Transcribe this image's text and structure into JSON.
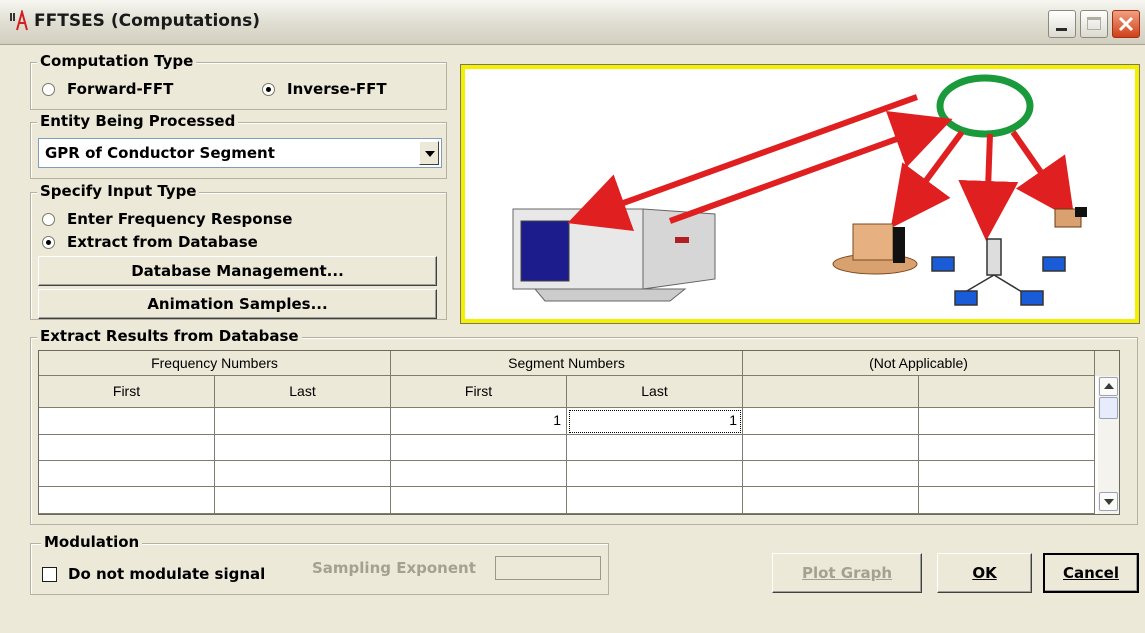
{
  "window": {
    "title": "FFTSES (Computations)"
  },
  "computation_type": {
    "legend": "Computation Type",
    "options": [
      {
        "label": "Forward-FFT",
        "selected": false
      },
      {
        "label": "Inverse-FFT",
        "selected": true
      }
    ]
  },
  "entity": {
    "legend": "Entity Being Processed",
    "selected": "GPR of Conductor Segment"
  },
  "input_type": {
    "legend": "Specify Input Type",
    "options": [
      {
        "label": "Enter Frequency Response",
        "selected": false
      },
      {
        "label": "Extract from Database",
        "selected": true
      }
    ],
    "db_button": "Database Management...",
    "anim_button": "Animation Samples..."
  },
  "extract": {
    "legend": "Extract Results from Database",
    "groups": [
      "Frequency Numbers",
      "Segment Numbers",
      "(Not Applicable)"
    ],
    "columns": [
      "First",
      "Last",
      "First",
      "Last",
      "",
      ""
    ],
    "rows": [
      [
        "",
        "",
        "1",
        "1",
        "",
        ""
      ],
      [
        "",
        "",
        "",
        "",
        "",
        ""
      ],
      [
        "",
        "",
        "",
        "",
        "",
        ""
      ],
      [
        "",
        "",
        "",
        "",
        "",
        ""
      ]
    ]
  },
  "modulation": {
    "legend": "Modulation",
    "checkbox_label": "Do not modulate signal",
    "checked": false,
    "exponent_label": "Sampling Exponent",
    "exponent_value": ""
  },
  "buttons": {
    "plot": "Plot Graph",
    "ok": "OK",
    "cancel": "Cancel"
  },
  "colors": {
    "arrow": "#e02020",
    "ellipse": "#1a9a3a",
    "frame": "#f3f000"
  }
}
